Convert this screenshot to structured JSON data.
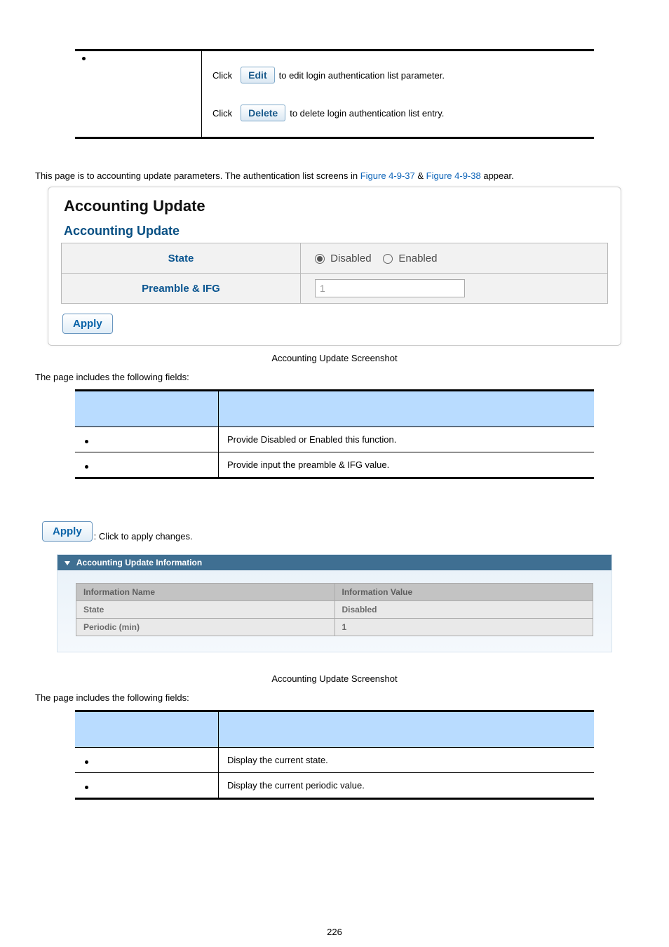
{
  "top_actions": {
    "click_word": "Click",
    "edit_label": "Edit",
    "edit_desc": " to edit login authentication list parameter.",
    "delete_label": "Delete",
    "delete_desc": " to delete login authentication list entry."
  },
  "intro": {
    "prefix": "This page is to accounting update parameters. The authentication list screens in ",
    "fig1": "Figure 4-9-37",
    "sep": " & ",
    "fig2": "Figure 4-9-38",
    "suffix": " appear."
  },
  "scr1": {
    "big_title": "Accounting Update",
    "sub_title": "Accounting Update",
    "row1_label": "State",
    "row1_opt1": "Disabled",
    "row1_opt2": "Enabled",
    "row2_label": "Preamble & IFG",
    "row2_value": "1",
    "apply": "Apply"
  },
  "caption1": "Accounting Update Screenshot",
  "fields_intro": "The page includes the following fields:",
  "fields1": {
    "r1": "Provide Disabled or Enabled this function.",
    "r2": "Provide input the preamble & IFG value."
  },
  "apply_note": {
    "btn": "Apply",
    "txt": ": Click to apply changes."
  },
  "scr2": {
    "bar": "Accounting Update Information",
    "th1": "Information Name",
    "th2": "Information Value",
    "r1c1": "State",
    "r1c2": "Disabled",
    "r2c1": "Periodic (min)",
    "r2c2": "1"
  },
  "caption2": "Accounting Update Screenshot",
  "fields2": {
    "r1": "Display the current state.",
    "r2": "Display the current periodic value."
  },
  "page_no": "226"
}
